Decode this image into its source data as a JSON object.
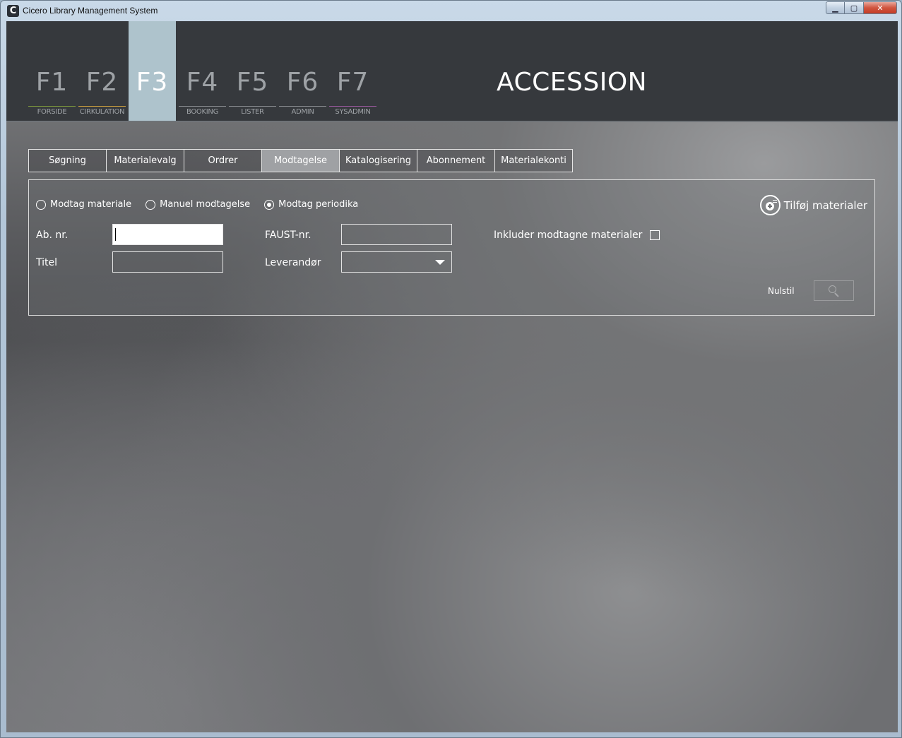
{
  "window": {
    "title": "Cicero Library Management System",
    "logo_letter": "C",
    "minimize_glyph": "▁",
    "maximize_glyph": "▢",
    "close_glyph": "✕"
  },
  "nav": {
    "fkeys": [
      {
        "key": "F1",
        "label": "FORSIDE",
        "accent": "#7f9a3d"
      },
      {
        "key": "F2",
        "label": "CIRKULATION",
        "accent": "#d0a340"
      },
      {
        "key": "F3",
        "label": "",
        "accent": "#aec3cc",
        "active": true
      },
      {
        "key": "F4",
        "label": "BOOKING",
        "accent": "#8b8e92"
      },
      {
        "key": "F5",
        "label": "LISTER",
        "accent": "#8b8e92"
      },
      {
        "key": "F6",
        "label": "ADMIN",
        "accent": "#8b8e92"
      },
      {
        "key": "F7",
        "label": "SYSADMIN",
        "accent": "#9c5aa0"
      }
    ],
    "page_title": "ACCESSION"
  },
  "subtabs": [
    {
      "label": "Søgning"
    },
    {
      "label": "Materialevalg"
    },
    {
      "label": "Ordrer"
    },
    {
      "label": "Modtagelse",
      "active": true
    },
    {
      "label": "Katalogisering"
    },
    {
      "label": "Abonnement"
    },
    {
      "label": "Materialekonti"
    }
  ],
  "form": {
    "radios": [
      {
        "label": "Modtag materiale",
        "checked": false
      },
      {
        "label": "Manuel modtagelse",
        "checked": false
      },
      {
        "label": "Modtag periodika",
        "checked": true
      }
    ],
    "ab_nr_label": "Ab. nr.",
    "ab_nr_value": "",
    "titel_label": "Titel",
    "titel_value": "",
    "faust_label": "FAUST-nr.",
    "faust_value": "",
    "leverandor_label": "Leverandør",
    "leverandor_value": "",
    "include_label": "Inkluder modtagne materialer",
    "include_checked": false,
    "add_label": "Tilføj materialer",
    "reset_label": "Nulstil"
  }
}
